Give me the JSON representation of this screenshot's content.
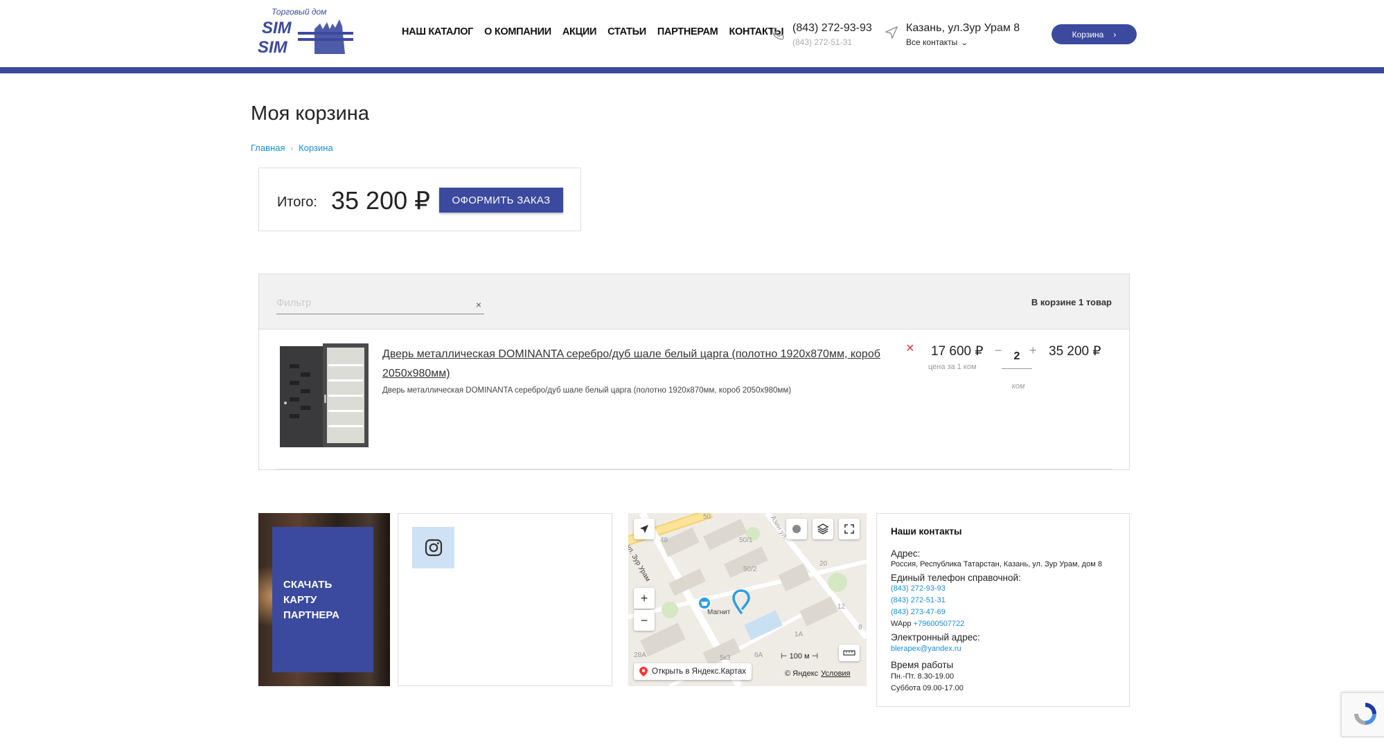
{
  "header": {
    "logo_tagline": "Торговый дом",
    "logo_text_top": "SIM",
    "logo_text_bottom": "SIM",
    "nav": [
      "НАШ КАТАЛОГ",
      "О КОМПАНИИ",
      "АКЦИИ",
      "СТАТЬИ",
      "ПАРТНЕРАМ",
      "КОНТАКТЫ"
    ],
    "phone_main": "(843) 272-93-93",
    "phone_sub": "(843) 272-51-31",
    "address_main": "Казань, ул.Зур Урам 8",
    "address_sub": "Все контакты",
    "cart_button": "Корзина",
    "accent_color": "#3b4a9e"
  },
  "page": {
    "title": "Моя корзина",
    "breadcrumb": [
      "Главная",
      "Корзина"
    ]
  },
  "total": {
    "label": "Итого:",
    "value": "35 200 ₽",
    "order_button": "ОФОРМИТЬ ЗАКАЗ"
  },
  "cart": {
    "filter_placeholder": "Фильтр",
    "filter_clear": "×",
    "count_text": "В корзине 1 товар",
    "items": [
      {
        "name": "Дверь металлическая DOMINANTA серебро/дуб шале белый царга (полотно 1920х870мм, короб 2050х980мм)",
        "description": "Дверь металлическая DOMINANTA серебро/дуб шале белый царга (полотно 1920х870мм, короб 2050х980мм)",
        "remove": "×",
        "unit_price": "17 600 ₽",
        "unit_note": "цена за 1 ком",
        "qty_minus": "−",
        "quantity": "2",
        "qty_plus": "+",
        "qty_unit": "ком",
        "line_total": "35 200 ₽"
      }
    ]
  },
  "partner": {
    "text": "СКАЧАТЬ КАРТУ ПАРТНЕРА"
  },
  "map": {
    "open_label": "Открыть в Яндекс.Картах",
    "scale": "100 м",
    "copyright": "© Яндекс",
    "terms": "Условия",
    "labels": [
      "Магнит",
      "ул. Зур Урам",
      "50",
      "48",
      "50/1",
      "50/2",
      "20",
      "12",
      "1А",
      "8",
      "28А",
      "5к3",
      "6А",
      "Азин ул."
    ]
  },
  "contacts": {
    "title": "Наши контакты",
    "address_label": "Адрес:",
    "address_value": "Россия, Республика Татарстан, Казань, ул. Зур Урам, дом 8",
    "phone_label": "Единый телефон справочной:",
    "phones": [
      "(843) 272-93-93",
      "(843) 272-51-31",
      "(843) 273-47-69"
    ],
    "wapp_label": "WApp",
    "wapp_value": "+79600507722",
    "email_label": "Электронный адрес:",
    "email_value": "blerapex@yandex.ru",
    "hours_label": "Время работы",
    "hours": [
      "Пн.-Пт. 8.30-19.00",
      "Суббота 09.00-17.00"
    ]
  }
}
